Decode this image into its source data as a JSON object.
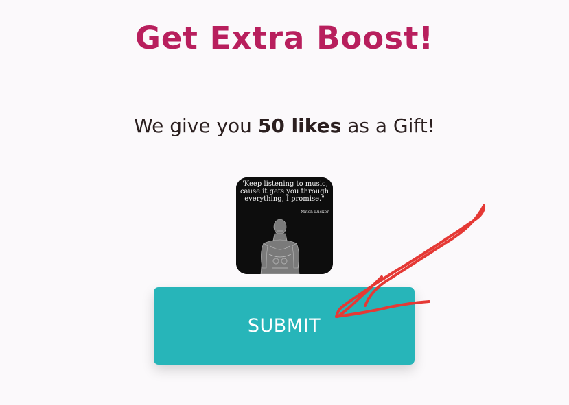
{
  "header": {
    "title": "Get Extra Boost!"
  },
  "offer": {
    "prefix": "We give you",
    "highlight": "50 likes",
    "suffix": "as a Gift!"
  },
  "image": {
    "quote": "\"Keep listening to music, cause it gets you through everything, I promise.\"",
    "author": "-Mitch Lucker"
  },
  "form": {
    "submit_label": "SUBMIT"
  },
  "colors": {
    "title": "#b81f5d",
    "button": "#27b5b9",
    "annotation_arrow": "#e53935"
  },
  "icons": {
    "annotation": "red-arrow-icon"
  }
}
